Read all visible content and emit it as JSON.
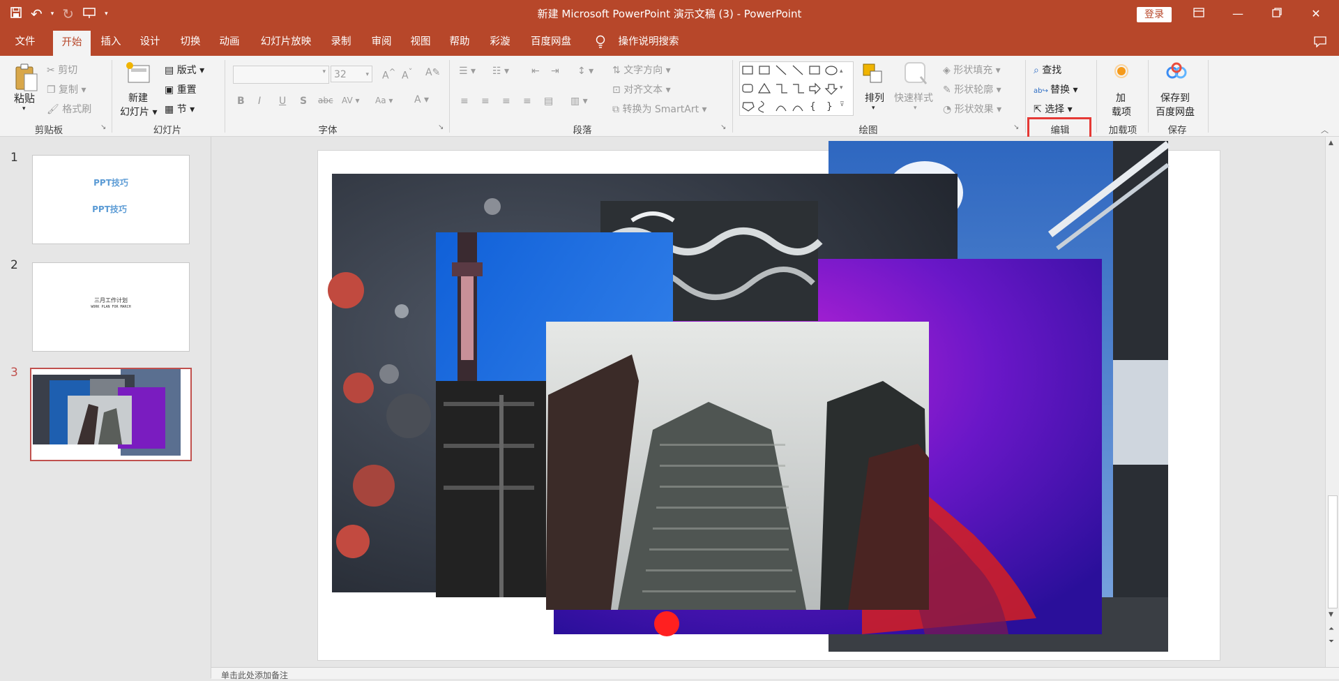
{
  "window": {
    "title": "新建 Microsoft PowerPoint 演示文稿 (3)  -  PowerPoint",
    "login_label": "登录"
  },
  "tabs": [
    {
      "label": "文件"
    },
    {
      "label": "开始"
    },
    {
      "label": "插入"
    },
    {
      "label": "设计"
    },
    {
      "label": "切换"
    },
    {
      "label": "动画"
    },
    {
      "label": "幻灯片放映"
    },
    {
      "label": "录制"
    },
    {
      "label": "审阅"
    },
    {
      "label": "视图"
    },
    {
      "label": "帮助"
    },
    {
      "label": "彩漩"
    },
    {
      "label": "百度网盘"
    },
    {
      "label": "操作说明搜索"
    }
  ],
  "ribbon": {
    "clipboard": {
      "paste": "粘贴",
      "cut": "剪切",
      "copy": "复制",
      "format_painter": "格式刷",
      "label": "剪贴板"
    },
    "slides": {
      "new_slide": "新建",
      "new_slide2": "幻灯片",
      "layout": "版式",
      "reset": "重置",
      "section": "节",
      "label": "幻灯片"
    },
    "font": {
      "size": "32",
      "label": "字体"
    },
    "paragraph": {
      "text_direction": "文字方向",
      "align_text": "对齐文本",
      "smartart": "转换为 SmartArt",
      "label": "段落"
    },
    "drawing": {
      "arrange": "排列",
      "quick_styles": "快速样式",
      "shape_fill": "形状填充",
      "shape_outline": "形状轮廓",
      "shape_effects": "形状效果",
      "label": "绘图"
    },
    "editing": {
      "find": "查找",
      "replace": "替换",
      "select": "选择",
      "label": "编辑"
    },
    "addins": {
      "addins1": "加",
      "addins2": "载项",
      "label": "加载项"
    },
    "save": {
      "save1": "保存到",
      "save2": "百度网盘",
      "label": "保存"
    }
  },
  "slides": [
    {
      "number": "1",
      "line1": "PPT技巧",
      "line2": "PPT技巧"
    },
    {
      "number": "2",
      "line1": "三月工作计划",
      "line2": "WORK PLAN FOR MARCH"
    },
    {
      "number": "3"
    }
  ],
  "notes": {
    "placeholder": "单击此处添加备注"
  },
  "colors": {
    "accent": "#b7472a",
    "highlight": "#e53935"
  }
}
